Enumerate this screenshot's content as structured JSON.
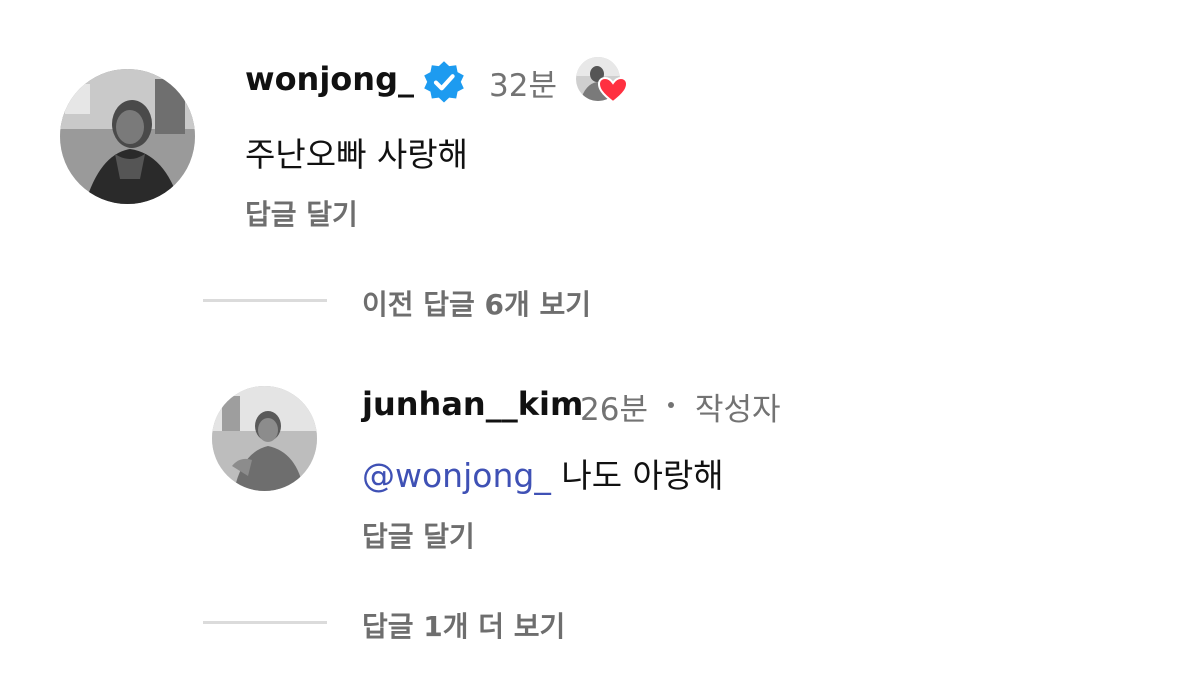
{
  "comments": [
    {
      "username": "wonjong_",
      "verified": true,
      "time": "32분",
      "text": "주난오빠 사랑해",
      "reply_label": "답글 달기",
      "liked_by_author": true
    }
  ],
  "view_previous": {
    "prefix": "이전 답글 ",
    "count": "6",
    "suffix": "개 보기"
  },
  "replies": [
    {
      "username": "junhan__kim",
      "time": "26분",
      "author_tag": "작성자",
      "mention": "@wonjong_",
      "text": "나도 아랑해",
      "reply_label": "답글 달기"
    }
  ],
  "view_more": {
    "prefix": "답글 ",
    "count": "1",
    "suffix": "개 더 보기"
  },
  "colors": {
    "verified": "#1d9bf0",
    "heart": "#ff3040",
    "mention": "#3f51b5",
    "muted": "#737373"
  },
  "icons": [
    "verified-icon",
    "heart-icon"
  ]
}
